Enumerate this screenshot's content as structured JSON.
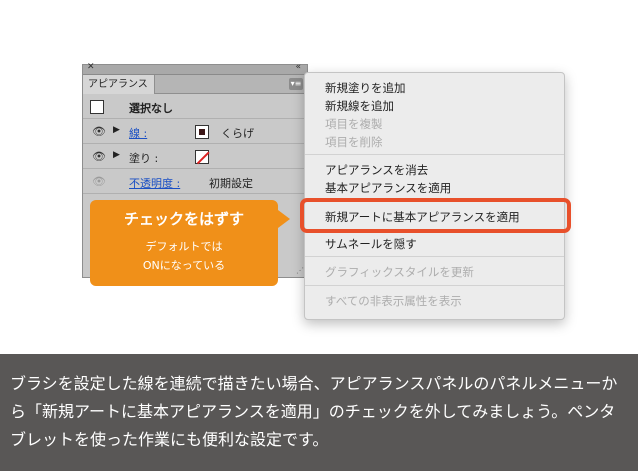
{
  "panel": {
    "tab_label": "アピアランス",
    "rows": [
      {
        "label": "選択なし"
      },
      {
        "label": "線 :",
        "value": "くらげ"
      },
      {
        "label": "塗り :"
      },
      {
        "label": "不透明度 :",
        "value": "初期設定"
      }
    ]
  },
  "menu": {
    "items": [
      {
        "label": "新規塗りを追加",
        "enabled": true
      },
      {
        "label": "新規線を追加",
        "enabled": true
      },
      {
        "label": "項目を複製",
        "enabled": false
      },
      {
        "label": "項目を削除",
        "enabled": false
      },
      {
        "label": "アピアランスを消去",
        "enabled": true
      },
      {
        "label": "基本アピアランスを適用",
        "enabled": true
      },
      {
        "label": "新規アートに基本アピアランスを適用",
        "enabled": true
      },
      {
        "label": "サムネールを隠す",
        "enabled": true
      },
      {
        "label": "グラフィックスタイルを更新",
        "enabled": false
      },
      {
        "label": "すべての非表示属性を表示",
        "enabled": false
      }
    ]
  },
  "callout": {
    "title": "チェックをはずす",
    "line1": "デフォルトでは",
    "line2": "ONになっている"
  },
  "caption": {
    "text": "ブラシを設定した線を連続で描きたい場合、アピアランスパネルのパネルメニューから「新規アートに基本アピアランスを適用」のチェックを外してみましょう。ペンタブレットを使った作業にも便利な設定です。"
  },
  "colors": {
    "highlight": "#e8502b",
    "callout": "#f09019",
    "caption_bg": "#595756",
    "link": "#1a4fc4"
  }
}
